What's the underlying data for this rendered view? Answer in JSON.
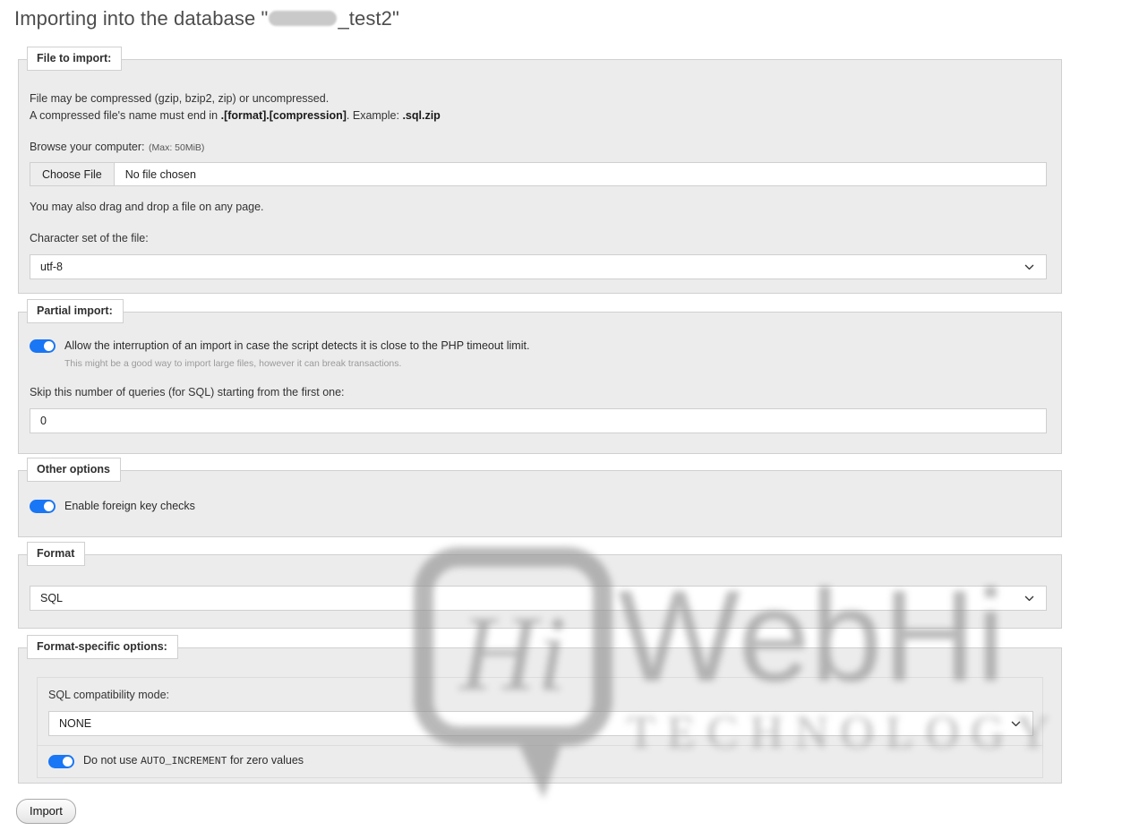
{
  "page": {
    "title_prefix": "Importing into the database \"",
    "title_suffix": "_test2\"",
    "redacted": true
  },
  "file_to_import": {
    "legend": "File to import:",
    "line1": "File may be compressed (gzip, bzip2, zip) or uncompressed.",
    "line2_prefix": "A compressed file's name must end in ",
    "line2_bold1": ".[format].[compression]",
    "line2_mid": ". Example: ",
    "line2_bold2": ".sql.zip",
    "browse_label": "Browse your computer:",
    "max_size": "(Max: 50MiB)",
    "choose_file_button": "Choose File",
    "file_status": "No file chosen",
    "drag_drop_note": "You may also drag and drop a file on any page.",
    "charset_label": "Character set of the file:",
    "charset_value": "utf-8"
  },
  "partial_import": {
    "legend": "Partial import:",
    "allow_interrupt_label": "Allow the interruption of an import in case the script detects it is close to the PHP timeout limit.",
    "allow_interrupt_hint": "This might be a good way to import large files, however it can break transactions.",
    "allow_interrupt_on": true,
    "skip_label": "Skip this number of queries (for SQL) starting from the first one:",
    "skip_value": "0"
  },
  "other_options": {
    "legend": "Other options",
    "foreign_key_label": "Enable foreign key checks",
    "foreign_key_on": true
  },
  "format": {
    "legend": "Format",
    "value": "SQL"
  },
  "format_specific": {
    "legend": "Format-specific options:",
    "compat_label": "SQL compatibility mode:",
    "compat_value": "NONE",
    "auto_increment_prefix": "Do not use ",
    "auto_increment_code": "AUTO_INCREMENT",
    "auto_increment_suffix": " for zero values",
    "auto_increment_on": true
  },
  "actions": {
    "import_button": "Import"
  },
  "watermark": {
    "brand": "WebHi",
    "tagline": "TECHNOLOGY",
    "bubble_text": "Hi",
    "color": "#8e8e8e"
  },
  "icons": {
    "chevron_down": "chevron-down-icon"
  }
}
